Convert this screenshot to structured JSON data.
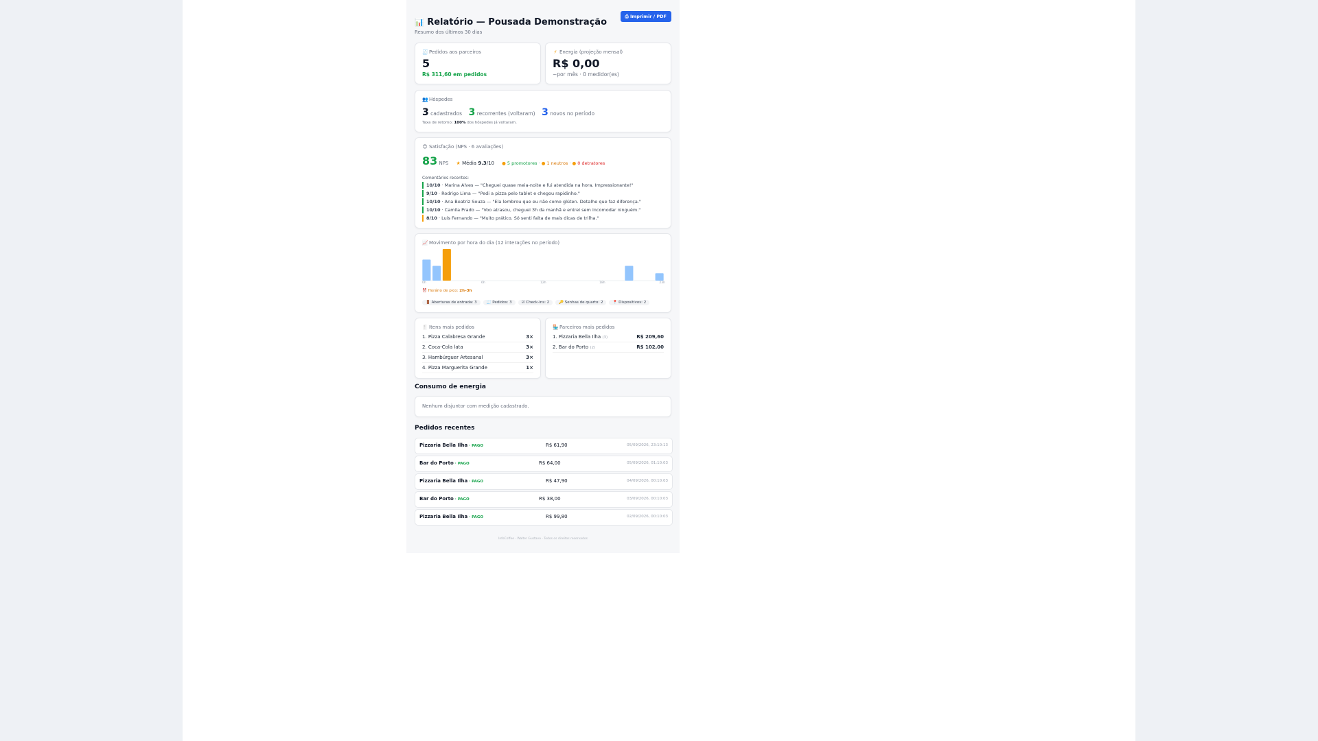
{
  "header": {
    "icon": "bar-chart-icon",
    "title": "Relatório — Pousada Demonstração",
    "subtitle": "Resumo dos últimos 30 dias",
    "print_label": "Imprimir / PDF"
  },
  "orders_card": {
    "label": "Pedidos aos parceiros",
    "value": "5",
    "sub": "R$ 311,60 em pedidos"
  },
  "energy_card": {
    "label": "Energia (projeção mensal)",
    "value": "R$ 0,00",
    "sub": "~por mês · 0 medidor(es)"
  },
  "guests": {
    "label": "Hóspedes",
    "registered": "3",
    "registered_label": "cadastrados",
    "returning": "3",
    "returning_label": "recorrentes (voltaram)",
    "new": "3",
    "new_label": "novos no período",
    "return_rate_prefix": "Taxa de retorno:",
    "return_rate": "100%",
    "return_rate_suffix": "dos hóspedes já voltaram."
  },
  "nps": {
    "label": "Satisfação (NPS · 6 avaliações)",
    "score": "83",
    "score_unit": "NPS",
    "avg_prefix": "Média",
    "avg": "9.3",
    "avg_suffix": "/10",
    "promoters": "5 promotores",
    "sep1": " · ",
    "neutrals": "1 neutros",
    "sep2": " · ",
    "detractors": "0 detratores",
    "comments_label": "Comentários recentes:",
    "comments": [
      {
        "score": "10/10",
        "text": " · Marina Alves — \"Cheguei quase meia-noite e fui atendida na hora. Impressionante!\"",
        "color": "#16a34a"
      },
      {
        "score": "9/10",
        "text": " · Rodrigo Lima — \"Pedi a pizza pelo tablet e chegou rapidinho.\"",
        "color": "#16a34a"
      },
      {
        "score": "10/10",
        "text": " · Ana Beatriz Souza — \"Ela lembrou que eu não como glúten. Detalhe que faz diferença.\"",
        "color": "#16a34a"
      },
      {
        "score": "10/10",
        "text": " · Camila Prado — \"Voo atrasou, cheguei 3h da manhã e entrei sem incomodar ninguém.\"",
        "color": "#16a34a"
      },
      {
        "score": "8/10",
        "text": " · Luís Fernando — \"Muito prático. Só senti falta de mais dicas de trilha.\"",
        "color": "#f59e0b"
      }
    ]
  },
  "activity": {
    "label": "Movimento por hora do dia (12 interações no período)",
    "ticks": [
      "0h",
      "6h",
      "12h",
      "18h",
      "23h"
    ],
    "peak_prefix": "Horário de pico:",
    "peak_value": "2h–3h",
    "chips": [
      {
        "icon": "door-icon",
        "text": "Aberturas de entrada: 3"
      },
      {
        "icon": "receipt-icon",
        "text": "Pedidos: 3"
      },
      {
        "icon": "check-icon",
        "text": "Check-ins: 2"
      },
      {
        "icon": "key-icon",
        "text": "Senhas de quarto: 2"
      },
      {
        "icon": "pin-icon",
        "text": "Dispositivos: 2"
      }
    ]
  },
  "chart_data": {
    "type": "bar",
    "title": "Movimento por hora do dia (12 interações no período)",
    "x": [
      0,
      1,
      2,
      3,
      4,
      5,
      6,
      7,
      8,
      9,
      10,
      11,
      12,
      13,
      14,
      15,
      16,
      17,
      18,
      19,
      20,
      21,
      22,
      23
    ],
    "values": [
      2,
      1.4,
      3,
      0,
      0,
      0,
      0,
      0,
      0,
      0,
      0,
      0,
      0,
      0,
      0,
      0,
      0,
      0,
      0,
      0,
      1.4,
      0,
      0,
      0.7
    ],
    "highlight_index": 2,
    "bar_color": "#93c5fd",
    "highlight_color": "#f59e0b"
  },
  "top_items": {
    "label": "Itens mais pedidos",
    "rows": [
      {
        "name": "1. Pizza Calabresa Grande",
        "qty": "3×"
      },
      {
        "name": "2. Coca-Cola lata",
        "qty": "3×"
      },
      {
        "name": "3. Hambúrguer Artesanal",
        "qty": "3×"
      },
      {
        "name": "4. Pizza Marguerita Grande",
        "qty": "1×"
      }
    ]
  },
  "top_partners": {
    "label": "Parceiros mais pedidos",
    "rows": [
      {
        "name": "1. Pizzaria Bella Ilha",
        "count": "(3)",
        "amount": "R$ 209,60"
      },
      {
        "name": "2. Bar do Porto",
        "count": "(2)",
        "amount": "R$ 102,00"
      }
    ]
  },
  "energy_section": {
    "title": "Consumo de energia",
    "empty": "Nenhum disjuntor com medição cadastrado."
  },
  "recent_orders": {
    "title": "Pedidos recentes",
    "rows": [
      {
        "partner": "Pizzaria Bella Ilha",
        "status": "PAGO",
        "amount": "R$ 61,90",
        "date": "05/09/2026, 23:10:13"
      },
      {
        "partner": "Bar do Porto",
        "status": "PAGO",
        "amount": "R$ 64,00",
        "date": "05/09/2026, 01:10:03"
      },
      {
        "partner": "Pizzaria Bella Ilha",
        "status": "PAGO",
        "amount": "R$ 47,90",
        "date": "04/09/2026, 00:10:03"
      },
      {
        "partner": "Bar do Porto",
        "status": "PAGO",
        "amount": "R$ 38,00",
        "date": "03/09/2026, 00:10:03"
      },
      {
        "partner": "Pizzaria Bella Ilha",
        "status": "PAGO",
        "amount": "R$ 99,80",
        "date": "02/09/2026, 00:10:03"
      }
    ]
  },
  "footer": "InfoCoffee · Walter Gustavo · Todos os direitos reservados"
}
